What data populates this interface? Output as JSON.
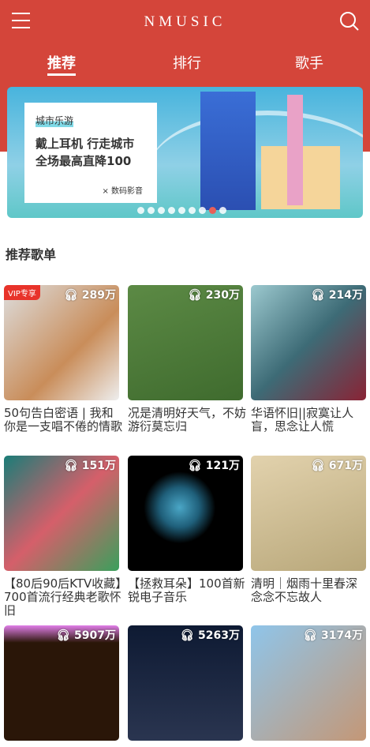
{
  "header": {
    "title": "NMUSIC",
    "menu_icon": "menu-icon",
    "search_icon": "search-icon"
  },
  "tabs": [
    {
      "label": "推荐",
      "active": true
    },
    {
      "label": "排行"
    },
    {
      "label": "歌手"
    }
  ],
  "banner": {
    "tag": "城市乐游",
    "headline_1": "戴上耳机 行走城市",
    "headline_2": "全场最高直降100",
    "sub": "× 数码影音",
    "dots": 9,
    "active_dot": 7
  },
  "section_title": "推荐歌单",
  "playlists": [
    {
      "count": "289万",
      "name": "50句告白密语 | 我和你是一支唱不倦的情歌",
      "vip": "VIP专享"
    },
    {
      "count": "230万",
      "name": "况是清明好天气，不妨游衍莫忘归"
    },
    {
      "count": "214万",
      "name": "华语怀旧||寂寞让人盲，思念让人慌"
    },
    {
      "count": "151万",
      "name": "【80后90后KTV收藏】700首流行经典老歌怀旧"
    },
    {
      "count": "121万",
      "name": "【拯救耳朵】100首新锐电子音乐"
    },
    {
      "count": "671万",
      "name": "清明｜烟雨十里春深 念念不忘故人"
    },
    {
      "count": "5907万",
      "name": ""
    },
    {
      "count": "5263万",
      "name": ""
    },
    {
      "count": "3174万",
      "name": ""
    }
  ],
  "colors": {
    "brand": "#d4453a",
    "active_dot": "#e86059"
  }
}
